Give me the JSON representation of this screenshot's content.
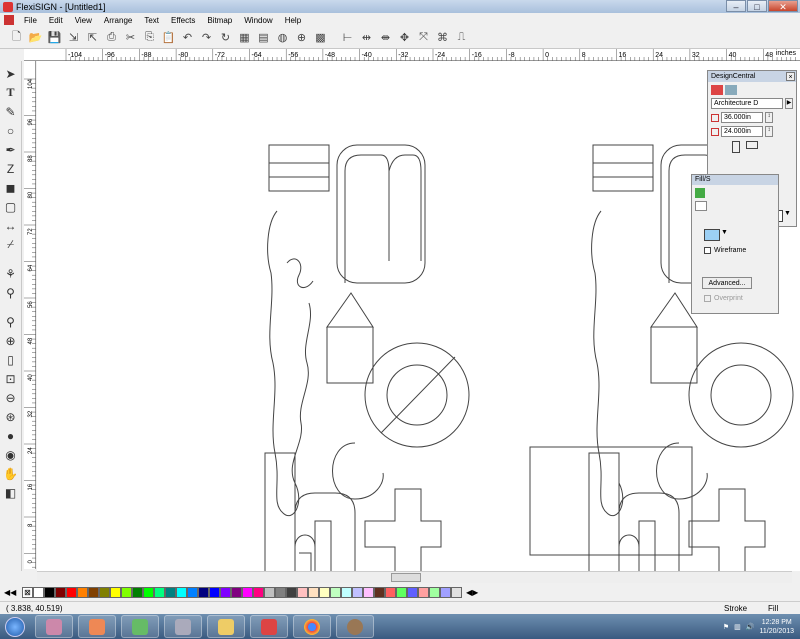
{
  "window": {
    "title": "FlexiSIGN - [Untitled1]"
  },
  "menu": [
    "File",
    "Edit",
    "View",
    "Arrange",
    "Text",
    "Effects",
    "Bitmap",
    "Window",
    "Help"
  ],
  "ruler": {
    "h_labels": [
      "-104",
      "-96",
      "-88",
      "-80",
      "-72",
      "-64",
      "-56",
      "-48",
      "-40",
      "-32",
      "-24",
      "-16",
      "-8",
      "0",
      "8",
      "16",
      "24",
      "32",
      "40",
      "48"
    ],
    "unit": "inches",
    "v_labels": [
      "104",
      "96",
      "88",
      "80",
      "72",
      "64",
      "56",
      "48",
      "40",
      "32",
      "24",
      "16",
      "8",
      "0"
    ]
  },
  "design_central": {
    "title": "DesignCentral",
    "font": "Architecture D",
    "width": "36.000in",
    "height": "24.000in"
  },
  "fill_panel": {
    "title": "Fill/S",
    "wireframe_label": "Wireframe",
    "advanced_label": "Advanced...",
    "overprint_label": "Overprint"
  },
  "status": {
    "coords": "(   3.838,    40.519)",
    "stroke_label": "Stroke",
    "fill_label": "Fill"
  },
  "taskbar": {
    "time": "12:28 PM",
    "date": "11/20/2013"
  },
  "palette_colors": [
    "#ffffff",
    "#000000",
    "#800000",
    "#ff0000",
    "#ff8000",
    "#804000",
    "#808000",
    "#ffff00",
    "#80ff00",
    "#008000",
    "#00ff00",
    "#00ff80",
    "#008080",
    "#00ffff",
    "#0080ff",
    "#000080",
    "#0000ff",
    "#8000ff",
    "#800080",
    "#ff00ff",
    "#ff0080",
    "#c0c0c0",
    "#808080",
    "#404040",
    "#ffc0c0",
    "#ffe0c0",
    "#ffffc0",
    "#c0ffc0",
    "#c0ffff",
    "#c0c0ff",
    "#ffc0ff",
    "#603020",
    "#ff6060",
    "#60ff60",
    "#6060ff",
    "#ffa0a0",
    "#a0ffa0",
    "#a0a0ff",
    "#e0e0e0"
  ]
}
